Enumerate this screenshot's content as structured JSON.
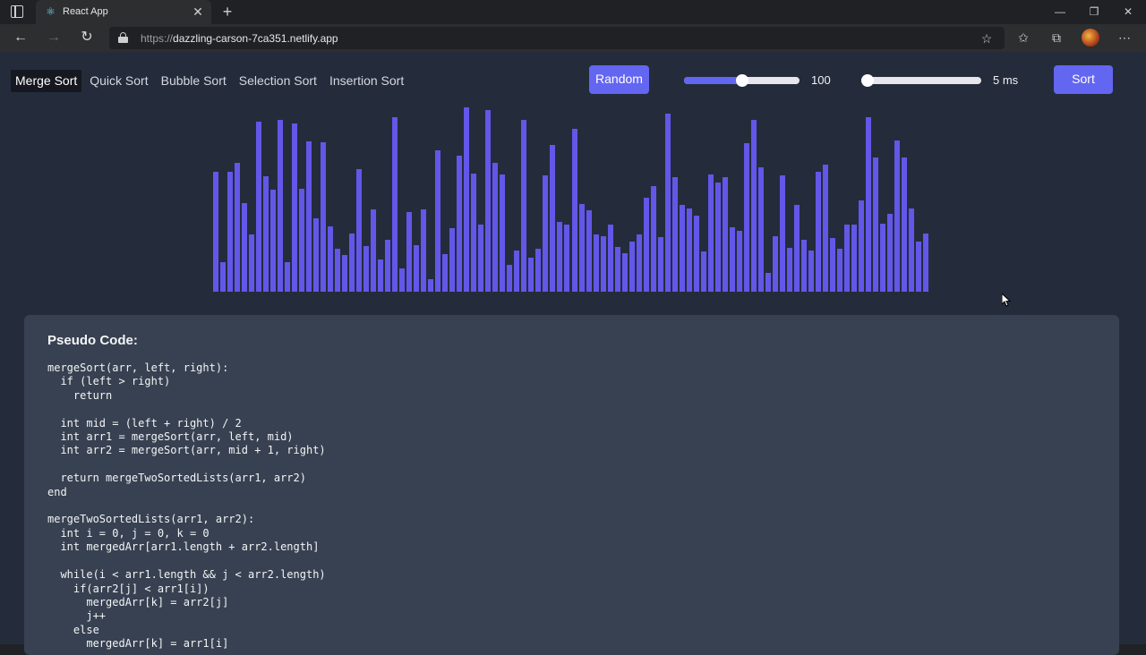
{
  "browser": {
    "tab_title": "React App",
    "url_scheme": "https://",
    "url_host": "dazzling-carson-7ca351.netlify.app",
    "icons": [
      "window-menu-icon",
      "react-favicon-icon",
      "close-tab-icon",
      "new-tab-icon",
      "minimize-icon",
      "restore-icon",
      "close-window-icon",
      "back-icon",
      "forward-icon",
      "refresh-icon",
      "lock-icon",
      "add-favorite-icon",
      "favorites-icon",
      "collections-icon",
      "profile-avatar",
      "more-menu-icon"
    ]
  },
  "app": {
    "algorithms": [
      {
        "label": "Merge Sort",
        "active": true
      },
      {
        "label": "Quick Sort",
        "active": false
      },
      {
        "label": "Bubble Sort",
        "active": false
      },
      {
        "label": "Selection Sort",
        "active": false
      },
      {
        "label": "Insertion Sort",
        "active": false
      }
    ],
    "random_label": "Random",
    "sort_label": "Sort",
    "array_size": {
      "value_label": "100",
      "fraction": 0.5
    },
    "speed": {
      "value_label": "5 ms",
      "fraction": 0.0
    },
    "bar_color": "#6257e8",
    "accent_color": "#6366f1",
    "bars": [
      129,
      20,
      129,
      139,
      91,
      54,
      189,
      123,
      107,
      191,
      20,
      187,
      108,
      165,
      73,
      164,
      63,
      36,
      29,
      55,
      132,
      40,
      84,
      24,
      47,
      194,
      13,
      81,
      41,
      84,
      0,
      155,
      30,
      61,
      148,
      206,
      127,
      66,
      203,
      140,
      126,
      17,
      34,
      191,
      26,
      36,
      125,
      161,
      69,
      65,
      180,
      90,
      83,
      54,
      51,
      65,
      39,
      31,
      45,
      54,
      98,
      112,
      50,
      199,
      122,
      89,
      85,
      76,
      33,
      126,
      116,
      122,
      62,
      58,
      163,
      191,
      134,
      8,
      51,
      125,
      38,
      89,
      47,
      34,
      129,
      137,
      49,
      37,
      65,
      65,
      94,
      194,
      146,
      67,
      78,
      166,
      146,
      85,
      45,
      55
    ],
    "pseudo_title": "Pseudo Code:",
    "pseudo_code": "mergeSort(arr, left, right):\n  if (left > right)\n    return\n\n  int mid = (left + right) / 2\n  int arr1 = mergeSort(arr, left, mid)\n  int arr2 = mergeSort(arr, mid + 1, right)\n\n  return mergeTwoSortedLists(arr1, arr2)\nend\n\nmergeTwoSortedLists(arr1, arr2):\n  int i = 0, j = 0, k = 0\n  int mergedArr[arr1.length + arr2.length]\n\n  while(i < arr1.length && j < arr2.length)\n    if(arr2[j] < arr1[i])\n      mergedArr[k] = arr2[j]\n      j++\n    else\n      mergedArr[k] = arr1[i]"
  }
}
